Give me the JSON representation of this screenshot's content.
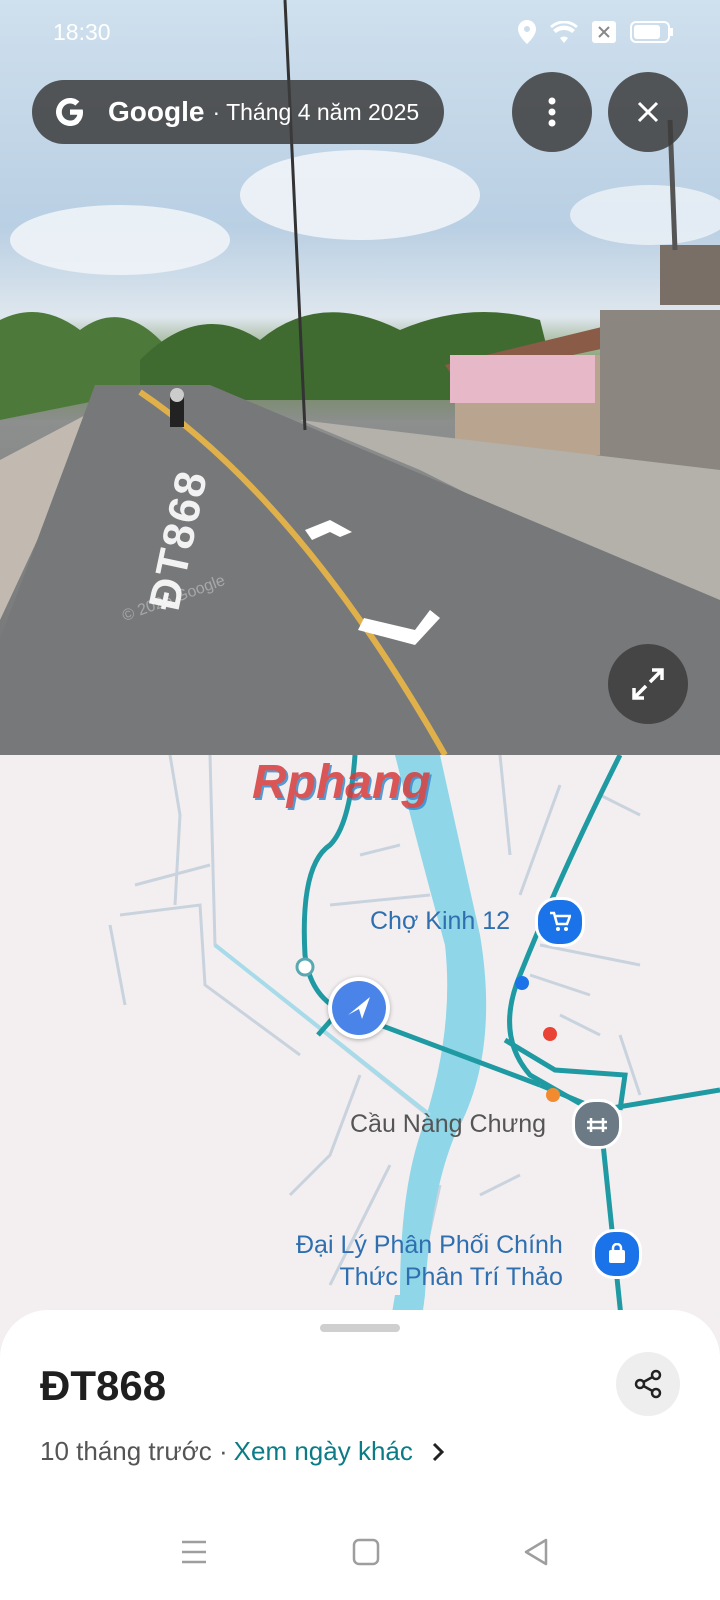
{
  "status_bar": {
    "time": "18:30",
    "icons": [
      "location-icon",
      "wifi-icon",
      "sim-icon",
      "battery-icon"
    ]
  },
  "header": {
    "brand": "Google",
    "date": "· Tháng 4 năm 2025"
  },
  "street_view": {
    "road_marking": "ĐT868",
    "watermark": "© 2026 Google"
  },
  "map": {
    "watermark": "Rphang",
    "places": [
      {
        "label": "Chợ Kinh 12",
        "icon": "shopping-cart-icon"
      },
      {
        "label": "Cầu Nàng Chưng",
        "icon": "bridge-icon"
      },
      {
        "label_line1": "Đại Lý Phân Phối Chính",
        "label_line2": "Thức Phân Trí Thảo",
        "icon": "shopping-bag-icon"
      }
    ]
  },
  "sheet": {
    "title": "ĐT868",
    "time_ago": "10 tháng trước ·",
    "other_dates_link": "Xem ngày khác"
  },
  "colors": {
    "road": "#1f9aa3",
    "river": "#8fd6e8",
    "link": "#0b7c86",
    "pin_blue": "#1a73e8"
  }
}
